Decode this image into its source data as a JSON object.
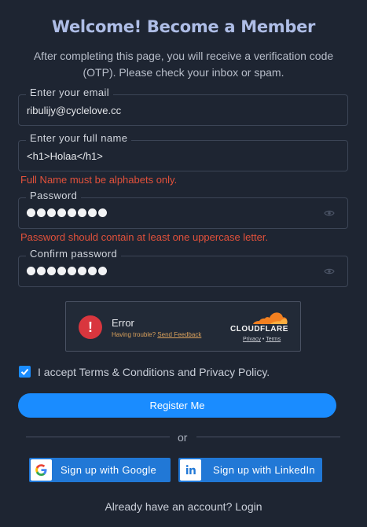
{
  "header": {
    "title": "Welcome! Become a Member",
    "subtitle": "After completing this page, you will receive a verification code (OTP). Please check your inbox or spam."
  },
  "form": {
    "email": {
      "label": "Enter your email",
      "value": "ribulijy@cyclelove.cc"
    },
    "fullname": {
      "label": "Enter your full name",
      "value": "<h1>Holaa</h1>",
      "error": "Full Name must be alphabets only."
    },
    "password": {
      "label": "Password",
      "masked_length": 8,
      "error": "Password should contain at least one uppercase letter."
    },
    "confirm_password": {
      "label": "Confirm password",
      "masked_length": 8
    }
  },
  "captcha": {
    "title": "Error",
    "trouble": "Having trouble?",
    "feedback": "Send Feedback",
    "brand": "CLOUDFLARE",
    "privacy": "Privacy",
    "separator": "•",
    "terms": "Terms"
  },
  "consent": {
    "checked": true,
    "prefix": "I accept ",
    "terms": "Terms & Conditions",
    "and": " and ",
    "privacy": "Privacy Policy",
    "suffix": "."
  },
  "register_label": "Register Me",
  "or_label": "or",
  "social": {
    "google": "Sign up with Google",
    "linkedin": "Sign up with LinkedIn"
  },
  "footer": {
    "prompt": "Already have an account? ",
    "login": "Login"
  },
  "colors": {
    "background": "#1e2532",
    "accent": "#1a8cff",
    "error": "#e2513b",
    "social": "#2178d6"
  }
}
